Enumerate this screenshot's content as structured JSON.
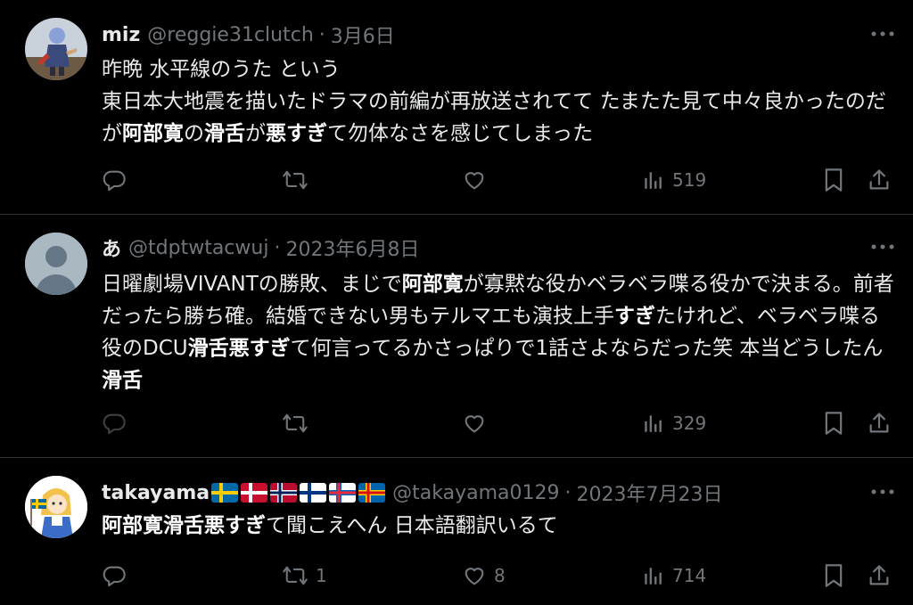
{
  "colors": {
    "background": "#000000",
    "text": "#e7e9ea",
    "muted": "#71767b",
    "divider": "#2f3336"
  },
  "tweets": [
    {
      "name": "miz",
      "handle": "@reggie31clutch",
      "separator": "·",
      "date": "3月6日",
      "avatar": "anime-character-avatar",
      "body_segments": [
        {
          "text": "昨晩 水平線のうた という\n東日本大地震を描いたドラマの前編が再放送されてて たまたた見て中々良かったのだが",
          "bold": false
        },
        {
          "text": "阿部寛",
          "bold": true
        },
        {
          "text": "の",
          "bold": false
        },
        {
          "text": "滑舌",
          "bold": true
        },
        {
          "text": "が",
          "bold": false
        },
        {
          "text": "悪すぎ",
          "bold": true
        },
        {
          "text": "て勿体なさを感じてしまった",
          "bold": false
        }
      ],
      "actions": {
        "reply_count": "",
        "retweet_count": "",
        "like_count": "",
        "views": "519"
      }
    },
    {
      "name": "あ",
      "handle": "@tdptwtacwuj",
      "separator": "·",
      "date": "2023年6月8日",
      "avatar": "default-avatar",
      "body_segments": [
        {
          "text": "日曜劇場VIVANTの勝敗、まじで",
          "bold": false
        },
        {
          "text": "阿部寛",
          "bold": true
        },
        {
          "text": "が寡黙な役かベラベラ喋る役かで決まる。前者だったら勝ち確。結婚できない男もテルマエも演技上手",
          "bold": false
        },
        {
          "text": "すぎ",
          "bold": true
        },
        {
          "text": "たけれど、ベラベラ喋る役のDCU",
          "bold": false
        },
        {
          "text": "滑舌悪すぎ",
          "bold": true
        },
        {
          "text": "て何言ってるかさっぱりで1話さよならだった笑 本当どうしたん",
          "bold": false
        },
        {
          "text": "滑舌",
          "bold": true
        }
      ],
      "actions": {
        "reply_count": "",
        "retweet_count": "",
        "like_count": "",
        "views": "329"
      }
    },
    {
      "name": "takayama",
      "handle": "@takayama0129",
      "separator": "·",
      "date": "2023年7月23日",
      "avatar": "cartoon-girl-avatar",
      "flags": [
        "sweden-flag",
        "denmark-flag",
        "norway-flag",
        "finland-flag",
        "faroe-flag",
        "aland-flag"
      ],
      "body_segments": [
        {
          "text": "阿部寛滑舌悪すぎ",
          "bold": true
        },
        {
          "text": "て聞こえへん 日本語翻訳いるて",
          "bold": false
        }
      ],
      "actions": {
        "reply_count": "",
        "retweet_count": "1",
        "like_count": "8",
        "views": "714"
      }
    }
  ]
}
